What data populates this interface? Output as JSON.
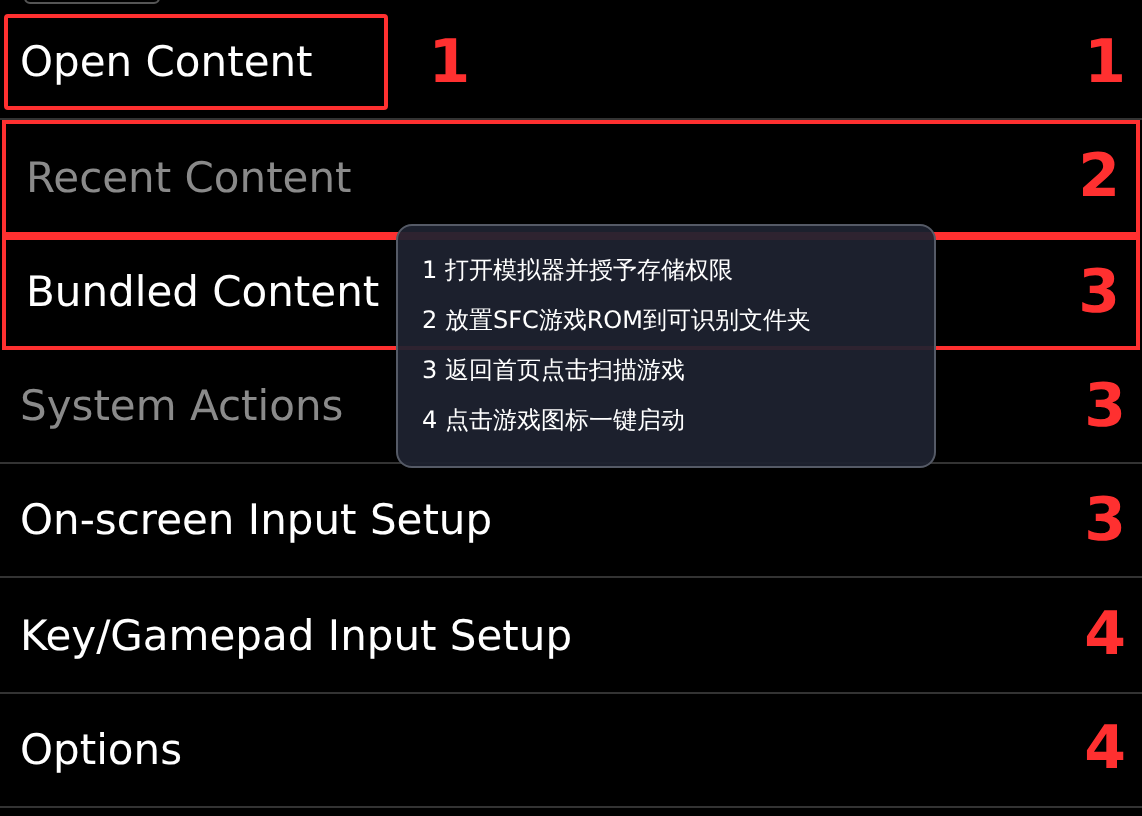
{
  "menu": {
    "items": [
      {
        "label": "Open Content",
        "disabled": false,
        "label_outlined": true,
        "row_outlined": false,
        "inline_step": "1",
        "step": "1"
      },
      {
        "label": "Recent Content",
        "disabled": true,
        "label_outlined": false,
        "row_outlined": true,
        "step": "2"
      },
      {
        "label": "Bundled Content",
        "disabled": false,
        "label_outlined": false,
        "row_outlined": true,
        "step": "3"
      },
      {
        "label": "System Actions",
        "disabled": true,
        "label_outlined": false,
        "row_outlined": false,
        "step": "3"
      },
      {
        "label": "On-screen Input Setup",
        "disabled": false,
        "label_outlined": false,
        "row_outlined": false,
        "step": "3"
      },
      {
        "label": "Key/Gamepad Input Setup",
        "disabled": false,
        "label_outlined": false,
        "row_outlined": false,
        "step": "4"
      },
      {
        "label": "Options",
        "disabled": false,
        "label_outlined": false,
        "row_outlined": false,
        "step": "4"
      }
    ]
  },
  "tooltip": {
    "lines": [
      "1 打开模拟器并授予存储权限",
      "2 放置SFC游戏ROM到可识别文件夹",
      "3 返回首页点击扫描游戏",
      "4 点击游戏图标一键启动"
    ]
  }
}
